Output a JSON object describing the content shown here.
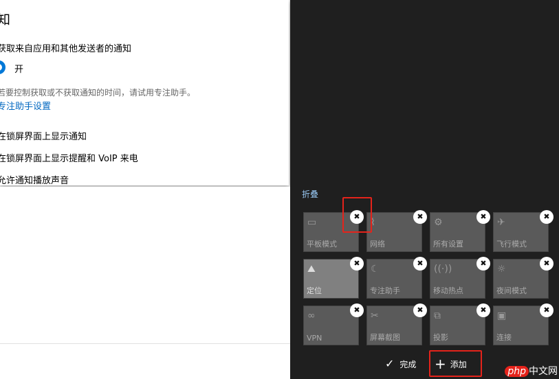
{
  "settings": {
    "title": "知",
    "section": "获取来自应用和其他发送者的通知",
    "toggle_label": "开",
    "hint": "若要控制获取或不获取通知的时间，请试用专注助手。",
    "link": "专注助手设置",
    "options": [
      "在锁屏界面上显示通知",
      "在锁屏界面上显示提醒和 VoIP 来电",
      "允许通知播放声音"
    ],
    "toggle_on": true
  },
  "action_center": {
    "collapse": "折叠",
    "tiles": [
      {
        "label": "平板模式",
        "icon": "▭"
      },
      {
        "label": "网络",
        "icon": "⌇"
      },
      {
        "label": "所有设置",
        "icon": "⚙"
      },
      {
        "label": "飞行模式",
        "icon": "✈"
      },
      {
        "label": "定位",
        "icon": "⛰",
        "active": true
      },
      {
        "label": "专注助手",
        "icon": "☾"
      },
      {
        "label": "移动热点",
        "icon": "((·))"
      },
      {
        "label": "夜间模式",
        "icon": "☼"
      },
      {
        "label": "VPN",
        "icon": "∞"
      },
      {
        "label": "屏幕截图",
        "icon": "✂"
      },
      {
        "label": "投影",
        "icon": "⧉"
      },
      {
        "label": "连接",
        "icon": "▣"
      }
    ],
    "unpin_icon": "✖",
    "done": "完成",
    "add": "添加"
  },
  "watermark": {
    "logo": "php",
    "text": "中文网"
  }
}
